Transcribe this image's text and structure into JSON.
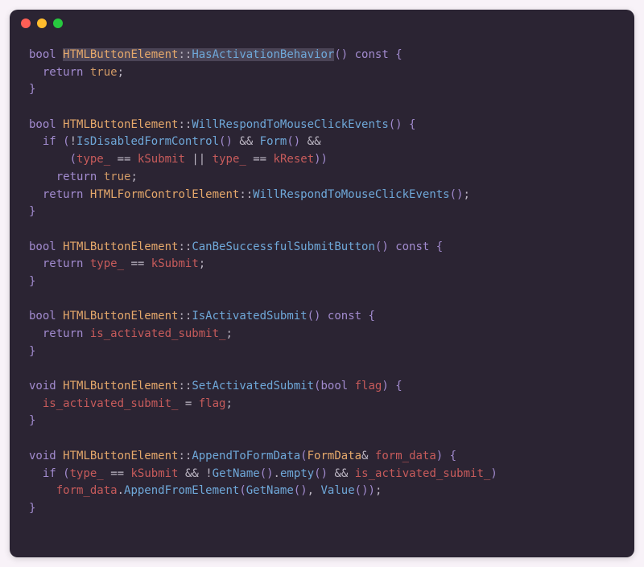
{
  "window": {
    "controls": [
      "close",
      "minimize",
      "zoom"
    ]
  },
  "colors": {
    "background": "#2b2433",
    "keyword": "#a28bcf",
    "type": "#e5a86b",
    "function": "#6fa8d9",
    "literal": "#d19a66",
    "identifier": "#c75b5b",
    "highlight": "#4b4456"
  },
  "code": {
    "language": "cpp",
    "highlight_range": "HTMLButtonElement::HasActivationBehavior",
    "lines": [
      "bool HTMLButtonElement::HasActivationBehavior() const {",
      "  return true;",
      "}",
      "",
      "bool HTMLButtonElement::WillRespondToMouseClickEvents() {",
      "  if (!IsDisabledFormControl() && Form() &&",
      "      (type_ == kSubmit || type_ == kReset))",
      "    return true;",
      "  return HTMLFormControlElement::WillRespondToMouseClickEvents();",
      "}",
      "",
      "bool HTMLButtonElement::CanBeSuccessfulSubmitButton() const {",
      "  return type_ == kSubmit;",
      "}",
      "",
      "bool HTMLButtonElement::IsActivatedSubmit() const {",
      "  return is_activated_submit_;",
      "}",
      "",
      "void HTMLButtonElement::SetActivatedSubmit(bool flag) {",
      "  is_activated_submit_ = flag;",
      "}",
      "",
      "void HTMLButtonElement::AppendToFormData(FormData& form_data) {",
      "  if (type_ == kSubmit && !GetName().empty() && is_activated_submit_)",
      "    form_data.AppendFromElement(GetName(), Value());",
      "}"
    ]
  }
}
